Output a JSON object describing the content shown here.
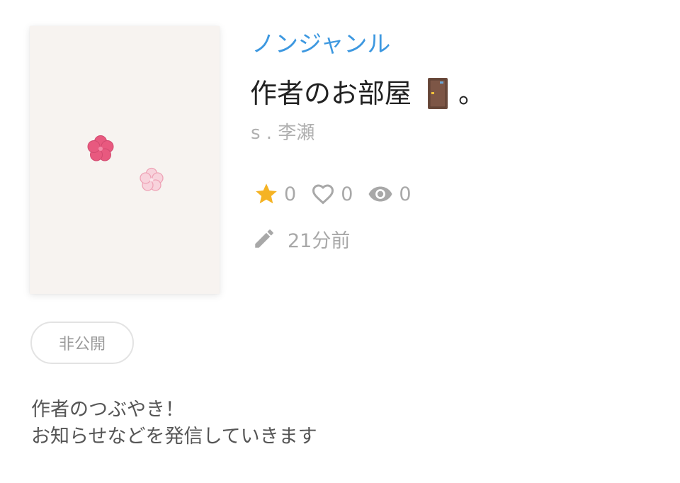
{
  "cover": {
    "icons": [
      "flower-icon",
      "flower-icon"
    ],
    "colors": {
      "background": "#f7f3f0",
      "flower_dark": "#e8597f",
      "flower_light": "#f6c3d0"
    }
  },
  "genre": "ノンジャンル",
  "title": {
    "text": "作者のお部屋",
    "emoji_icon": "door-icon",
    "suffix": "。"
  },
  "author": "s . 李瀬",
  "stats": {
    "stars": "0",
    "likes": "0",
    "views": "0",
    "icons": [
      "star-icon",
      "heart-icon",
      "eye-icon"
    ]
  },
  "updated": {
    "icon": "pencil-icon",
    "text": "21分前"
  },
  "visibility_badge": "非公開",
  "description": {
    "line1": "作者のつぶやき！",
    "line2": "お知らせなどを発信していきます"
  },
  "colors": {
    "genre": "#3d98e0",
    "star": "#f5b324",
    "muted": "#a8a8a8"
  }
}
